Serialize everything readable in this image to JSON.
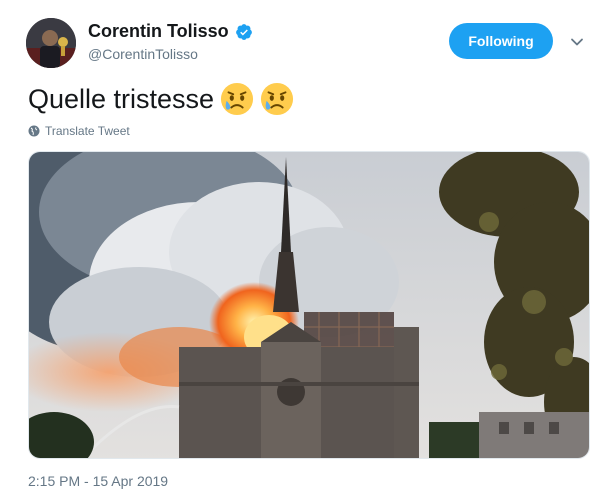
{
  "tweet": {
    "author_name": "Corentin Tolisso",
    "author_handle": "@CorentinTolisso",
    "text": "Quelle tristesse",
    "emojis": [
      "sad-but-relieved-face",
      "sad-but-relieved-face"
    ],
    "translate_label": "Translate Tweet",
    "timestamp": "2:15 PM - 15 Apr 2019",
    "media_description": "Notre-Dame cathedral fire photo"
  },
  "actions": {
    "follow_label": "Following"
  },
  "colors": {
    "accent": "#1da1f2",
    "text_primary": "#14171a",
    "text_secondary": "#657786",
    "verified": "#1da1f2"
  }
}
